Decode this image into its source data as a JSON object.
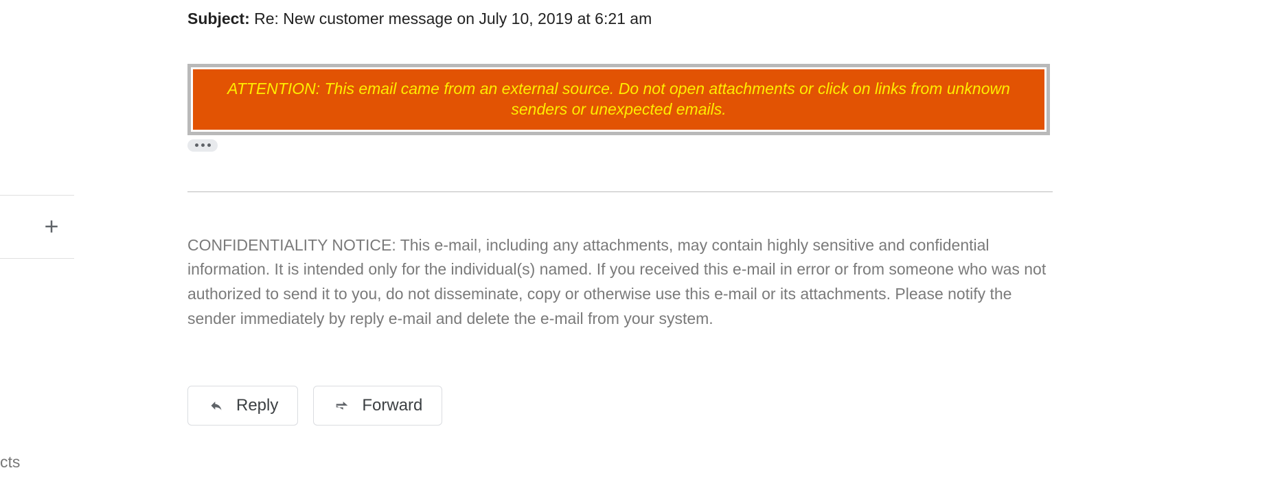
{
  "sidebar": {
    "label_cut": "cts"
  },
  "header": {
    "subject_label": "Subject:",
    "subject_value": "Re: New customer message on July 10, 2019 at 6:21 am"
  },
  "banner": {
    "text": "ATTENTION: This email came from an external source. Do not open attachments or click on links from unknown senders or unexpected emails."
  },
  "confidentiality": {
    "text": "CONFIDENTIALITY NOTICE: This e-mail, including any attachments, may contain highly sensitive and confidential information. It is intended only for the individual(s) named. If you received this e-mail in error or from someone who was not authorized to send it to you, do not disseminate, copy or otherwise use this e-mail or its attachments. Please notify the sender immediately by reply e-mail and delete the e-mail from your system."
  },
  "actions": {
    "reply": "Reply",
    "forward": "Forward"
  }
}
